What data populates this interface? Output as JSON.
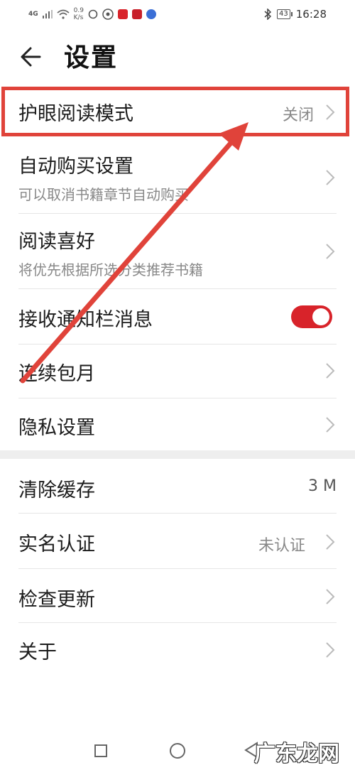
{
  "status_bar": {
    "signal": "4G",
    "net_speed_value": "0.9",
    "net_speed_unit": "K/s",
    "battery": "43",
    "time": "16:28"
  },
  "header": {
    "title": "设置"
  },
  "section1": [
    {
      "label": "护眼阅读模式",
      "value": "关闭"
    },
    {
      "label": "自动购买设置",
      "subtitle": "可以取消书籍章节自动购买"
    },
    {
      "label": "阅读喜好",
      "subtitle": "将优先根据所选分类推荐书籍"
    },
    {
      "label": "接收通知栏消息",
      "toggle_on": true
    },
    {
      "label": "连续包月"
    },
    {
      "label": "隐私设置"
    }
  ],
  "section2": [
    {
      "label": "清除缓存",
      "value": "3 M"
    },
    {
      "label": "实名认证",
      "value": "未认证"
    },
    {
      "label": "检查更新"
    },
    {
      "label": "关于"
    }
  ],
  "colors": {
    "accent": "#d8232a",
    "annotation": "#e0433a"
  },
  "watermark": "广东龙网"
}
